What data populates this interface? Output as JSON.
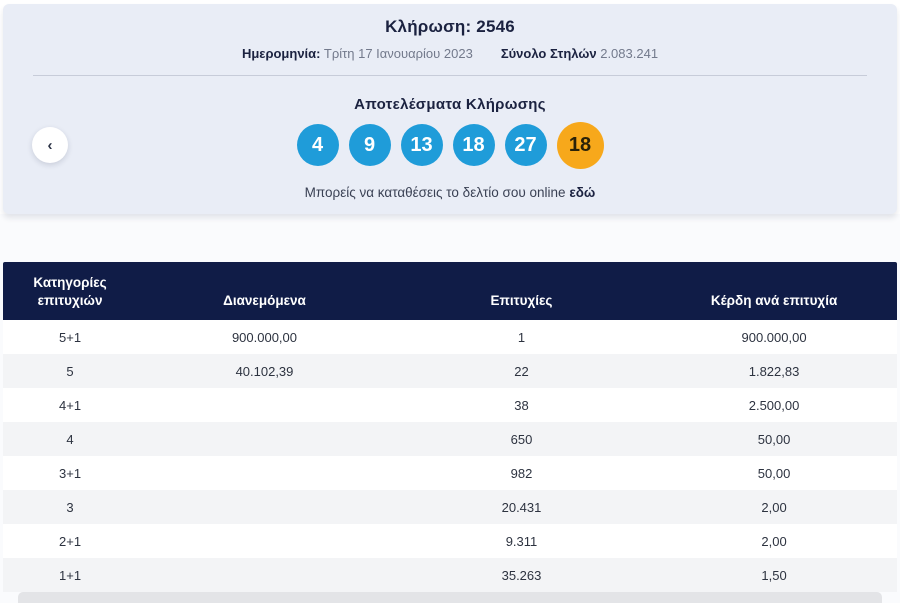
{
  "header": {
    "draw_label": "Κλήρωση:",
    "draw_number": "2546",
    "date_label": "Ημερομηνία:",
    "date_value": "Τρίτη 17 Ιανουαρίου 2023",
    "columns_label": "Σύνολο Στηλών",
    "columns_value": "2.083.241"
  },
  "results": {
    "title": "Αποτελέσματα Κλήρωσης",
    "numbers": [
      "4",
      "9",
      "13",
      "18",
      "27"
    ],
    "bonus_number": "18",
    "cta_text": "Μπορείς να καταθέσεις το δελτίο σου online",
    "cta_link_text": "εδώ",
    "prev_arrow_glyph": "‹"
  },
  "table": {
    "headers": [
      "Κατηγορίες επιτυχιών",
      "Διανεμόμενα",
      "Επιτυχίες",
      "Κέρδη ανά επιτυχία"
    ],
    "rows": [
      {
        "category": "5+1",
        "distributed": "900.000,00",
        "wins": "1",
        "per_win": "900.000,00"
      },
      {
        "category": "5",
        "distributed": "40.102,39",
        "wins": "22",
        "per_win": "1.822,83"
      },
      {
        "category": "4+1",
        "distributed": "",
        "wins": "38",
        "per_win": "2.500,00"
      },
      {
        "category": "4",
        "distributed": "",
        "wins": "650",
        "per_win": "50,00"
      },
      {
        "category": "3+1",
        "distributed": "",
        "wins": "982",
        "per_win": "50,00"
      },
      {
        "category": "3",
        "distributed": "",
        "wins": "20.431",
        "per_win": "2,00"
      },
      {
        "category": "2+1",
        "distributed": "",
        "wins": "9.311",
        "per_win": "2,00"
      },
      {
        "category": "1+1",
        "distributed": "",
        "wins": "35.263",
        "per_win": "1,50"
      }
    ]
  },
  "colors": {
    "ball_blue": "#1f9cd9",
    "ball_orange": "#f7a81b",
    "header_navy": "#101c47",
    "card_background": "#e9edf6"
  }
}
